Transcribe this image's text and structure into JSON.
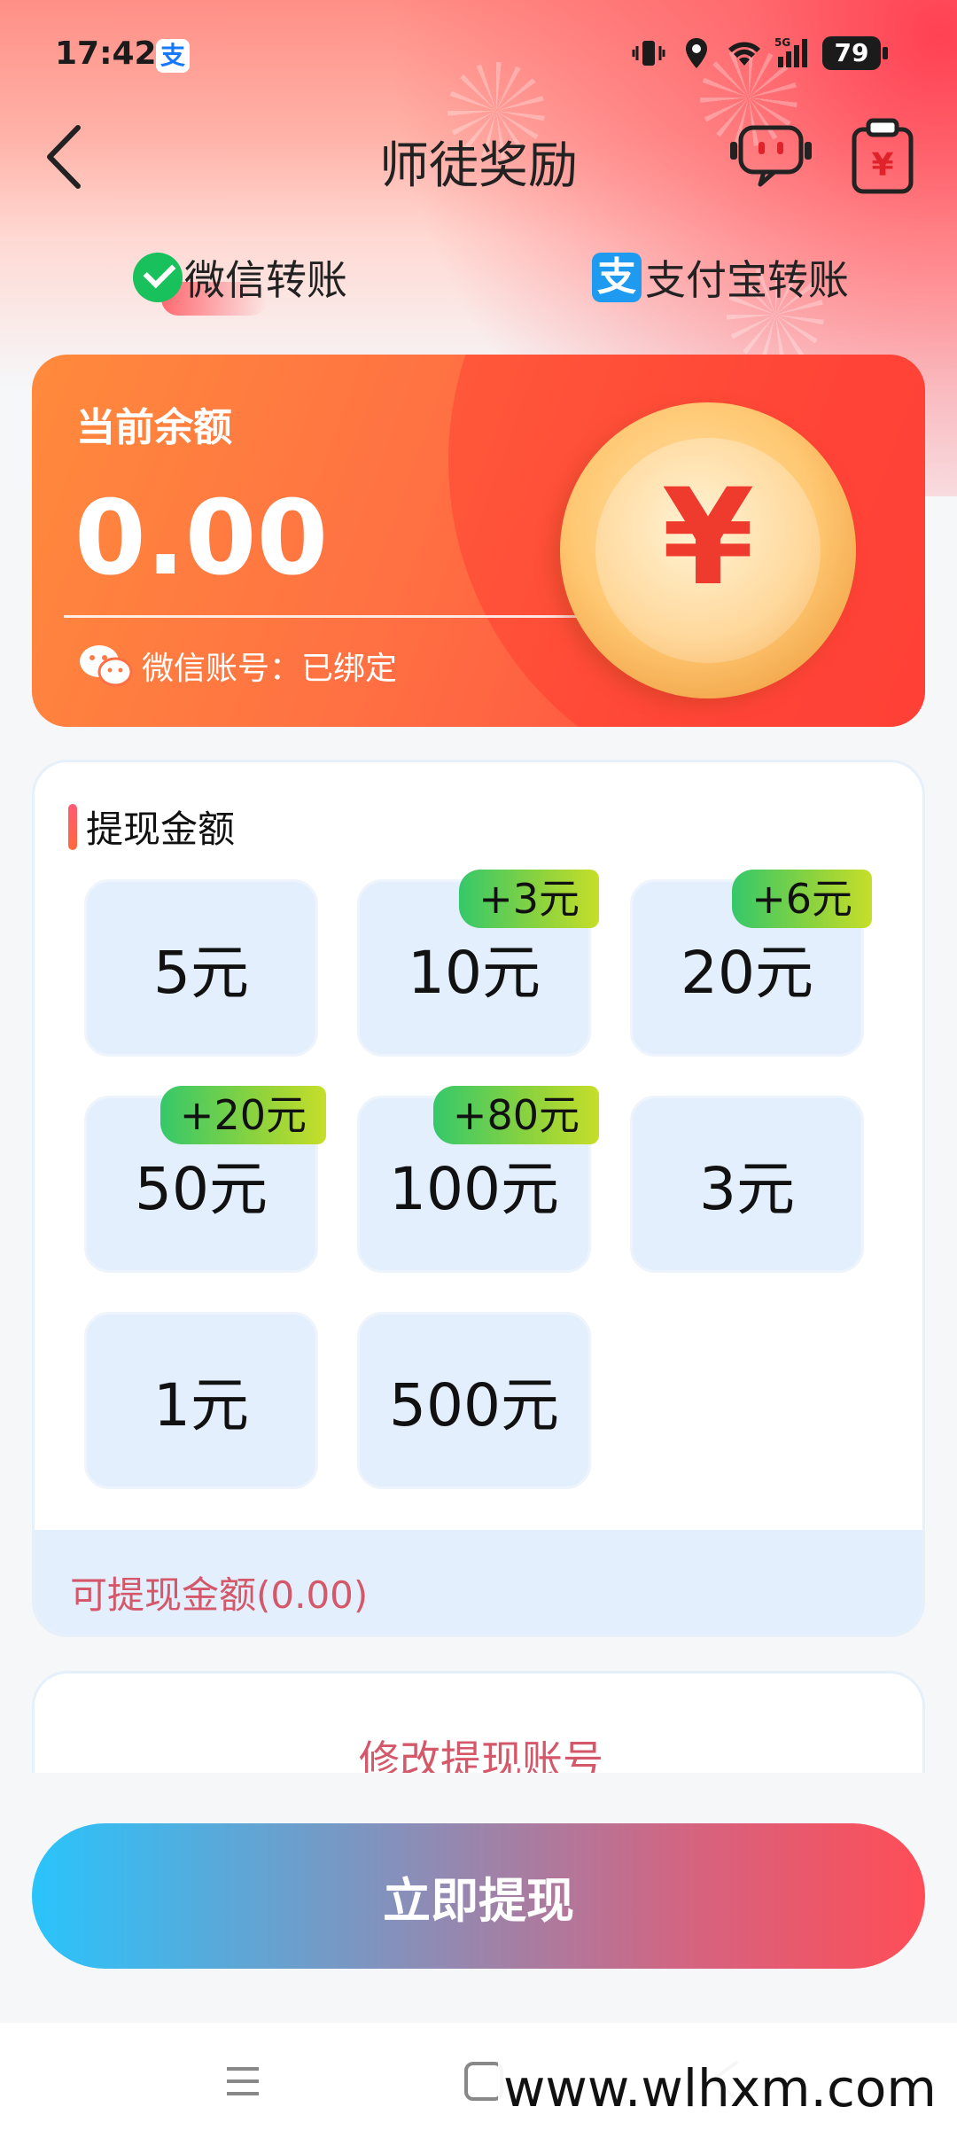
{
  "status_bar": {
    "time": "17:42",
    "app_badge": "支",
    "signal_label": "5G",
    "battery": "79"
  },
  "nav": {
    "title": "师徒奖励"
  },
  "transfer_options": [
    {
      "label": "微信转账",
      "icon": "wechat-check-icon",
      "selected": true
    },
    {
      "label": "支付宝转账",
      "icon": "alipay-icon",
      "icon_glyph": "支",
      "selected": false
    }
  ],
  "balance": {
    "label": "当前余额",
    "value": "0.00",
    "wechat_account_label": "微信账号：已绑定",
    "coin_symbol": "¥"
  },
  "withdraw": {
    "title": "提现金额",
    "amounts": [
      {
        "label": "5元",
        "bonus": ""
      },
      {
        "label": "10元",
        "bonus": "+3元"
      },
      {
        "label": "20元",
        "bonus": "+6元"
      },
      {
        "label": "50元",
        "bonus": "+20元"
      },
      {
        "label": "100元",
        "bonus": "+80元"
      },
      {
        "label": "3元",
        "bonus": ""
      },
      {
        "label": "1元",
        "bonus": ""
      },
      {
        "label": "500元",
        "bonus": ""
      }
    ],
    "withdrawable": "可提现金额(0.00)"
  },
  "modify_account": {
    "label": "修改提现账号"
  },
  "action": {
    "withdraw_now": "立即提现"
  },
  "watermark": "www.wlhxm.com",
  "colors": {
    "accent_red": "#ff4d57",
    "accent_blue": "#29c4fb",
    "card_orange": "#ff6f43",
    "tile_bg": "#e4effd",
    "bonus_green": "#8fd33c",
    "hint_text": "#d4586a"
  }
}
